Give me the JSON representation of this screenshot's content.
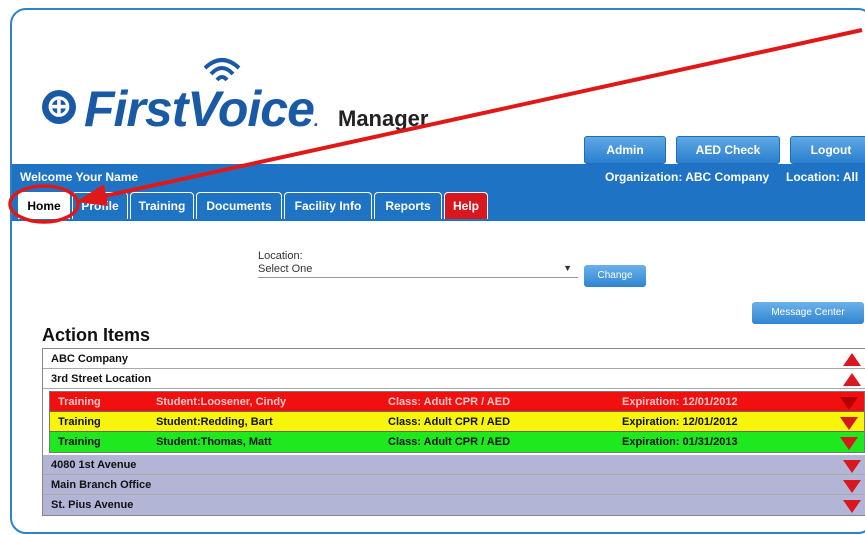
{
  "brand": {
    "logo_letter": "⊕",
    "logo_main": "First",
    "logo_voice": "Voice",
    "logo_tm": ".",
    "logo_sub": "Manager"
  },
  "header": {
    "buttons": [
      "Admin",
      "AED Check",
      "Logout"
    ]
  },
  "infobar": {
    "welcome": "Welcome Your Name",
    "organization": "Organization: ABC Company",
    "location": "Location: All"
  },
  "tabs": [
    "Home",
    "Profile",
    "Training",
    "Documents",
    "Facility Info",
    "Reports",
    "Help"
  ],
  "location_filter": {
    "label": "Location:",
    "value": "Select One",
    "change_button": "Change"
  },
  "message_center_button": "Message Center",
  "action_items": {
    "title": "Action Items",
    "company": "ABC Company",
    "expanded_location": "3rd Street Location",
    "items": [
      {
        "type": "Training",
        "student": "Student:Loosener, Cindy",
        "class": "Class: Adult CPR / AED",
        "expiration": "Expiration: 12/01/2012",
        "status_color": "#f20f0f"
      },
      {
        "type": "Training",
        "student": "Student:Redding, Bart",
        "class": "Class: Adult CPR / AED",
        "expiration": "Expiration: 12/01/2012",
        "status_color": "#f8f40a"
      },
      {
        "type": "Training",
        "student": "Student:Thomas, Matt",
        "class": "Class: Adult CPR / AED",
        "expiration": "Expiration: 01/31/2013",
        "status_color": "#1ee81e"
      }
    ],
    "collapsed_locations": [
      "4080 1st Avenue",
      "Main Branch Office",
      "St. Pius Avenue"
    ]
  },
  "colors": {
    "brand_blue": "#1f73c5",
    "alert_red": "#d8171e",
    "annotation_red": "#e01818"
  }
}
